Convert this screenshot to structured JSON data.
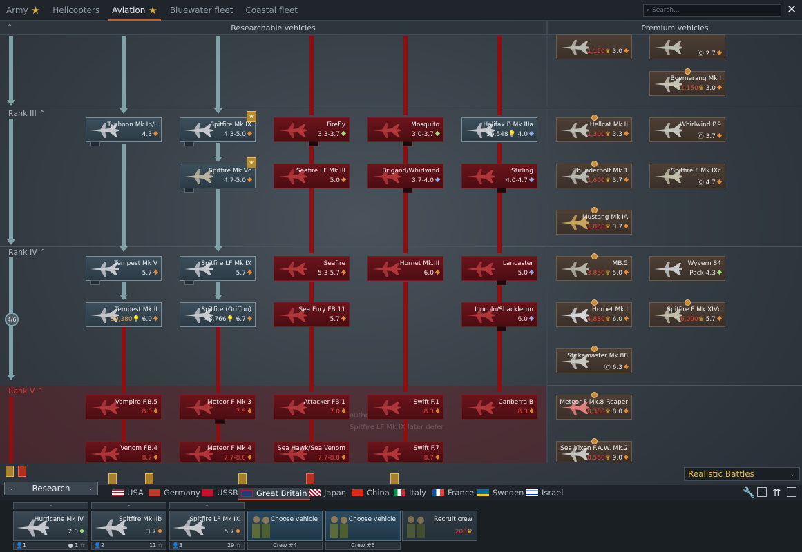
{
  "tabs": [
    {
      "label": "Army",
      "star": true
    },
    {
      "label": "Helicopters",
      "star": false
    },
    {
      "label": "Aviation",
      "star": true,
      "active": true
    },
    {
      "label": "Bluewater fleet",
      "star": false
    },
    {
      "label": "Coastal fleet",
      "star": false
    }
  ],
  "search": {
    "placeholder": "Search..."
  },
  "headers": {
    "researchable": "Researchable vehicles",
    "premium": "Premium vehicles"
  },
  "ranks": {
    "r3": "Rank III",
    "r4": "Rank IV",
    "r5": "Rank V"
  },
  "rank_progress": "4/6",
  "research": {
    "top_prem": [
      {
        "name": "",
        "cost": "1,150",
        "br": "3.0"
      },
      {
        "name": "",
        "cost": "",
        "br": "2.7"
      }
    ],
    "r3": [
      {
        "name": "Typhoon Mk Ib/L",
        "stat": "4.3"
      },
      {
        "name": "Spitfire Mk IX",
        "stat": "4.3-5.0"
      },
      {
        "name": "Firefly",
        "stat": "3.3-3.7"
      },
      {
        "name": "Mosquito",
        "stat": "3.0-3.7"
      },
      {
        "name": "Halifax B Mk IIIa",
        "rp": "36,548",
        "stat": "4.0"
      },
      {
        "name": "Spitfire Mk Vc",
        "stat": "4.7-5.0"
      },
      {
        "name": "Seafire LF Mk III",
        "stat": "5.0"
      },
      {
        "name": "Brigand/Whirlwind",
        "stat": "3.7-4.0"
      },
      {
        "name": "Stirling",
        "stat": "4.0-4.7"
      }
    ],
    "r4": [
      {
        "name": "Tempest Mk V",
        "stat": "5.7"
      },
      {
        "name": "Spitfire LF Mk IX",
        "stat": "5.7"
      },
      {
        "name": "Seafire",
        "stat": "5.3-5.7"
      },
      {
        "name": "Hornet Mk.III",
        "stat": "6.0"
      },
      {
        "name": "Lancaster",
        "stat": "5.0"
      },
      {
        "name": "Tempest Mk II",
        "rp": "39,380",
        "stat": "6.0"
      },
      {
        "name": "Spitfire (Griffon)",
        "rp": "48,766",
        "stat": "6.7"
      },
      {
        "name": "Sea Fury FB 11",
        "stat": "5.7"
      },
      {
        "name": "Lincoln/Shackleton",
        "stat": "6.0"
      }
    ],
    "r5": [
      {
        "name": "Vampire F.B.5",
        "stat": "8.0"
      },
      {
        "name": "Meteor F Mk 3",
        "stat": "7.5"
      },
      {
        "name": "Attacker FB 1",
        "stat": "7.0"
      },
      {
        "name": "Swift F.1",
        "stat": "8.3"
      },
      {
        "name": "Canberra B",
        "stat": "8.3"
      },
      {
        "name": "Venom FB.4",
        "stat": "8.7"
      },
      {
        "name": "Meteor F Mk 4",
        "stat": "7.7-8.0"
      },
      {
        "name": "Sea Hawk/Sea Venom",
        "stat": "7.7-8.0"
      },
      {
        "name": "Swift F.7",
        "stat": "8.7"
      }
    ]
  },
  "premium": [
    {
      "name": "Boomerang Mk I",
      "cost": "1,150",
      "br": "3.0"
    },
    {
      "name": "Hellcat Mk II",
      "cost": "1,300",
      "br": "3.3"
    },
    {
      "name": "Whirlwind P.9",
      "cost": "",
      "br": "3.7"
    },
    {
      "name": "Thunderbolt Mk.1",
      "cost": "1,600",
      "br": "3.7"
    },
    {
      "name": "Spitfire F Mk IXc",
      "cost": "",
      "br": "4.7"
    },
    {
      "name": "Mustang Mk IA",
      "cost": "1,850",
      "br": "3.7"
    },
    {
      "name": "MB.5",
      "cost": "3,850",
      "br": "5.0"
    },
    {
      "name": "Wyvern S4",
      "cost": "Pack",
      "br": "4.3"
    },
    {
      "name": "Hornet Mk.I",
      "cost": "4,880",
      "br": "6.0"
    },
    {
      "name": "Spitfire F Mk XIVc",
      "cost": "6,090",
      "br": "5.7"
    },
    {
      "name": "Strikemaster Mk.88",
      "cost": "",
      "br": "6.3"
    },
    {
      "name": "Meteor F Mk.8 Reaper",
      "cost": "8,380",
      "br": "8.0"
    },
    {
      "name": "Sea Vixen F.A.W. Mk.2",
      "cost": "8,560",
      "br": "9.0"
    }
  ],
  "ghost_text": {
    "l1": "Spitfire LF Mk IX later defer",
    "l2": "authorize vehicle"
  },
  "game_mode": "Realistic Battles",
  "research_button": "Research",
  "nations": [
    {
      "label": "USA"
    },
    {
      "label": "Germany"
    },
    {
      "label": "USSR"
    },
    {
      "label": "Great Britain",
      "active": true
    },
    {
      "label": "Japan"
    },
    {
      "label": "China"
    },
    {
      "label": "Italy"
    },
    {
      "label": "France"
    },
    {
      "label": "Sweden"
    },
    {
      "label": "Israel"
    }
  ],
  "crew": [
    {
      "name": "Hurricane Mk IV",
      "br": "2.0",
      "slot": "1",
      "extra": "1",
      "head": "–"
    },
    {
      "name": "Spitfire Mk IIb",
      "br": "3.7",
      "slot": "2",
      "extra": "11",
      "head": "–"
    },
    {
      "name": "Spitfire LF Mk IX",
      "br": "5.7",
      "slot": "3",
      "extra": "29",
      "head": "–"
    },
    {
      "name": "Choose vehicle",
      "foot": "Crew #4"
    },
    {
      "name": "Choose vehicle",
      "foot": "Crew #5"
    },
    {
      "name": "Recruit crew",
      "cost": "200"
    }
  ],
  "colors": {
    "accent": "#d9581f",
    "gold": "#e0b640",
    "locked": "#8e0e12",
    "researched_line": "#7fa2a8"
  }
}
